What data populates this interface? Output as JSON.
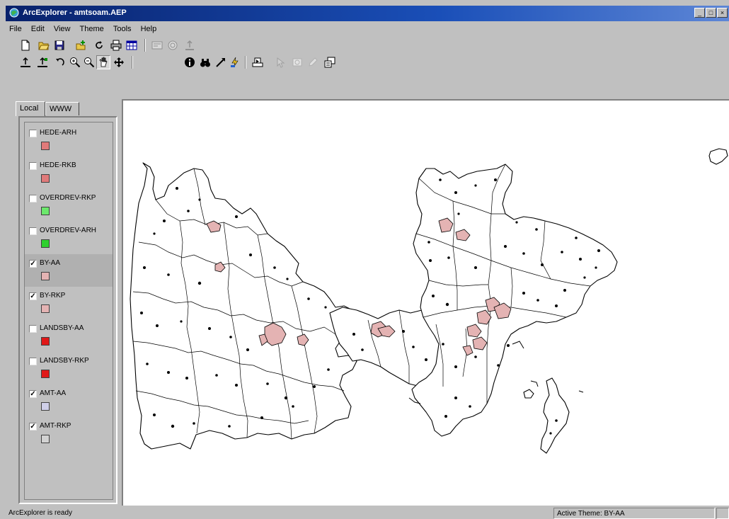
{
  "window": {
    "title": "ArcExplorer - amtsoam.AEP",
    "controls": [
      "_",
      "□",
      "×"
    ]
  },
  "menu": [
    "File",
    "Edit",
    "View",
    "Theme",
    "Tools",
    "Help"
  ],
  "toolbar1": [
    {
      "name": "new-project",
      "icon": "blank-page-icon"
    },
    {
      "name": "open-project",
      "icon": "folder-open-icon"
    },
    {
      "name": "save-project",
      "icon": "floppy-disk-icon"
    },
    {
      "name": "add-theme",
      "icon": "add-theme-icon"
    },
    {
      "name": "refresh",
      "icon": "refresh-icon"
    },
    {
      "name": "print",
      "icon": "printer-icon"
    },
    {
      "name": "attribute-table",
      "icon": "table-icon"
    },
    {
      "name": "query-builder",
      "icon": "query-icon"
    },
    {
      "name": "find-tool",
      "icon": "globe-icon"
    },
    {
      "name": "export",
      "icon": "export-icon"
    }
  ],
  "toolbar2": [
    {
      "name": "zoom-full-extent",
      "icon": "full-extent-icon"
    },
    {
      "name": "zoom-active-theme",
      "icon": "zoom-theme-icon"
    },
    {
      "name": "zoom-previous",
      "icon": "undo-arrow-icon"
    },
    {
      "name": "zoom-in",
      "icon": "zoom-in-icon"
    },
    {
      "name": "zoom-out",
      "icon": "zoom-out-icon"
    },
    {
      "name": "pan",
      "icon": "hand-icon"
    },
    {
      "name": "pan-direction",
      "icon": "pan-arrows-icon"
    },
    {
      "name": "identify",
      "icon": "info-icon"
    },
    {
      "name": "find",
      "icon": "binoculars-icon"
    },
    {
      "name": "measure",
      "icon": "measure-icon"
    },
    {
      "name": "hyperlink",
      "icon": "lightning-icon"
    },
    {
      "name": "select",
      "icon": "select-icon"
    },
    {
      "name": "select-graphic",
      "icon": "pointer-icon"
    },
    {
      "name": "clear-selection",
      "icon": "clear-icon"
    },
    {
      "name": "edit-tool",
      "icon": "pencil-icon"
    },
    {
      "name": "properties",
      "icon": "properties-icon"
    }
  ],
  "tabs": [
    "Local",
    "WWW"
  ],
  "themes": [
    {
      "name": "HEDE-ARH",
      "checked": false,
      "color": "#e07a7a"
    },
    {
      "name": "HEDE-RKB",
      "checked": false,
      "color": "#e07a7a"
    },
    {
      "name": "OVERDREV-RKP",
      "checked": false,
      "color": "#6ce86c"
    },
    {
      "name": "OVERDREV-ARH",
      "checked": false,
      "color": "#2ed12e"
    },
    {
      "name": "BY-AA",
      "checked": true,
      "color": "#e4b3b3",
      "active": true
    },
    {
      "name": "BY-RKP",
      "checked": true,
      "color": "#e4b3b3"
    },
    {
      "name": "LANDSBY-AA",
      "checked": false,
      "color": "#e01818"
    },
    {
      "name": "LANDSBY-RKP",
      "checked": false,
      "color": "#e01818"
    },
    {
      "name": "AMT-AA",
      "checked": true,
      "color": "#cfcfe8"
    },
    {
      "name": "AMT-RKP",
      "checked": true,
      "color": "#d2d2d2"
    }
  ],
  "status": {
    "left": "ArcExplorer is ready",
    "right": "Active Theme: BY-AA"
  },
  "colors": {
    "title_bar": "#08216b",
    "chrome": "#c0c0c0",
    "map_bg": "#ffffff",
    "city_fill": "#e4b3b3"
  }
}
